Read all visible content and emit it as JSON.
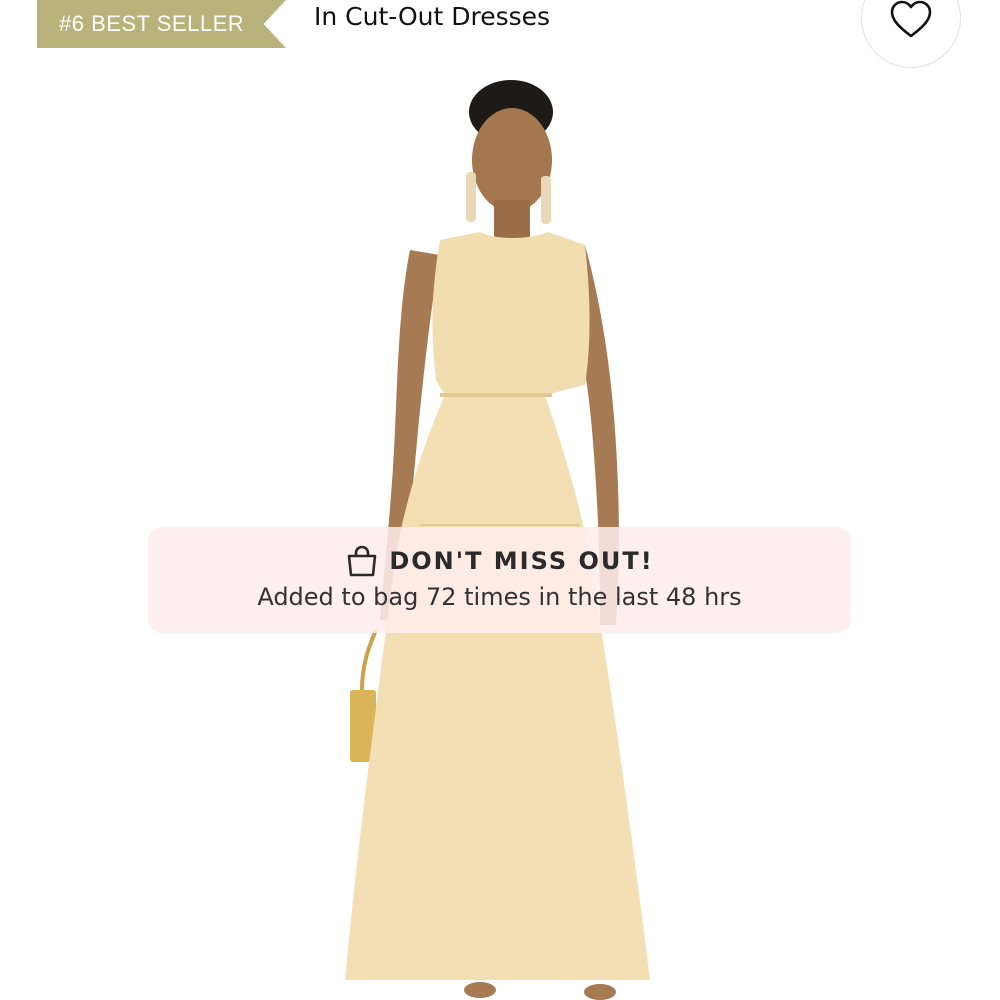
{
  "badge": {
    "label": "#6 BEST SELLER",
    "color": "#b9b27a"
  },
  "category": {
    "label": "In Cut-Out Dresses"
  },
  "wishlist": {
    "icon": "heart-icon"
  },
  "product_image": {
    "alt": "Model wearing a sleeveless cream cut-out maxi dress holding a woven handbag"
  },
  "toast": {
    "icon": "shopping-bag-icon",
    "title": "DON'T MISS OUT!",
    "message": "Added to bag 72 times in the last 48 hrs",
    "background": "#ffecec"
  }
}
